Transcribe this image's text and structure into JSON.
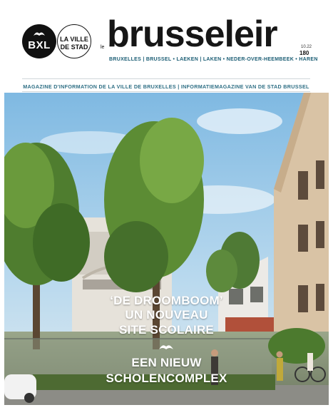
{
  "header": {
    "logo_bxl": "BXL",
    "logo_ville_line1": "LA VILLE",
    "logo_ville_line2": "DE STAD",
    "prefix": "le",
    "title": "brusseleir",
    "issue_date": "10.22",
    "issue_number": "180",
    "districts": "BRUXELLES | BRUSSEL • LAEKEN | LAKEN • NEDER-OVER-HEEMBEEK • HAREN",
    "subtitle": "MAGAZINE D'INFORMATION DE LA VILLE DE BRUXELLES | INFORMATIEMAGAZINE VAN DE STAD BRUSSEL"
  },
  "cover": {
    "headline_line1": "‘DE DROOMBOOM’",
    "headline_line2": "UN NOUVEAU",
    "headline_line3": "SITE SCOLAIRE",
    "headline_line4": "EEN NIEUW",
    "headline_line5": "SCHOLENCOMPLEX",
    "separator_icon": "bird-icon"
  },
  "colors": {
    "accent": "#2f6f85",
    "brand_text": "#161616",
    "sky": "#8fc3e6",
    "foliage": "#5f8b3a"
  }
}
